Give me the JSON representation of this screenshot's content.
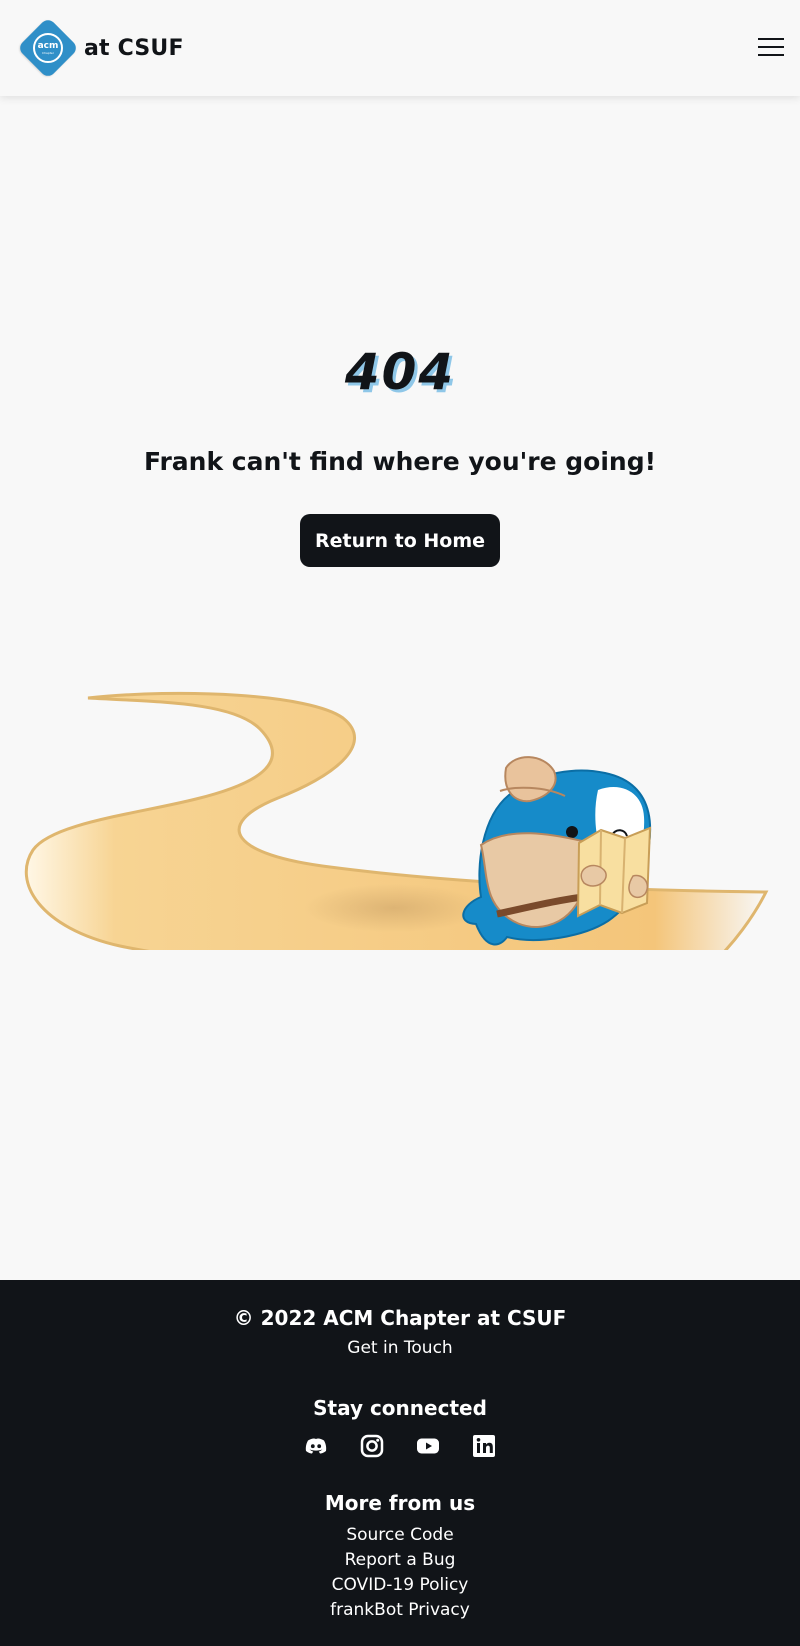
{
  "header": {
    "logo_text": "acm",
    "logo_subtext": "Chapter",
    "brand_label": "at CSUF",
    "menu_icon": "hamburger-icon"
  },
  "main": {
    "error_code": "404",
    "message": "Frank can't find where you're going!",
    "home_button_label": "Return to Home",
    "illustration": "frank-shark-with-map-on-sand-path"
  },
  "footer": {
    "copyright": "© 2022 ACM Chapter at CSUF",
    "get_in_touch": "Get in Touch",
    "stay_connected_title": "Stay connected",
    "social": [
      {
        "name": "Discord",
        "icon": "discord-icon"
      },
      {
        "name": "Instagram",
        "icon": "instagram-icon"
      },
      {
        "name": "YouTube",
        "icon": "youtube-icon"
      },
      {
        "name": "LinkedIn",
        "icon": "linkedin-icon"
      }
    ],
    "more_title": "More from us",
    "more_links": [
      "Source Code",
      "Report a Bug",
      "COVID-19 Policy",
      "frankBot Privacy"
    ]
  },
  "colors": {
    "background": "#f8f8f8",
    "text": "#111418",
    "footer_background": "#111418",
    "brand_blue": "#2f8fc8",
    "sand": "#f4c97b"
  }
}
